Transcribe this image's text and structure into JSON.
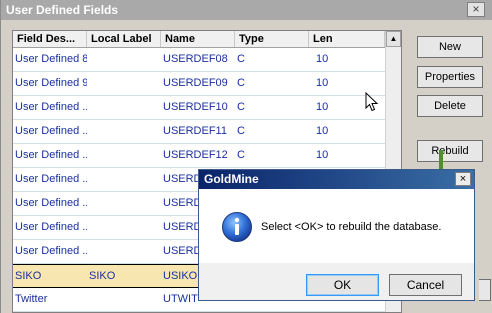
{
  "window": {
    "title": "User Defined Fields",
    "close_glyph": "×"
  },
  "list": {
    "columns": [
      "Field Des...",
      "Local Label",
      "Name",
      "Type",
      "Len"
    ],
    "rows": [
      [
        "User Defined 8",
        "",
        "USERDEF08",
        "C",
        "10"
      ],
      [
        "User Defined 9",
        "",
        "USERDEF09",
        "C",
        "10"
      ],
      [
        "User Defined ...",
        "",
        "USERDEF10",
        "C",
        "10"
      ],
      [
        "User Defined ...",
        "",
        "USERDEF11",
        "C",
        "10"
      ],
      [
        "User Defined ...",
        "",
        "USERDEF12",
        "C",
        "10"
      ],
      [
        "User Defined ...",
        "",
        "USERD",
        "",
        ""
      ],
      [
        "User Defined ...",
        "",
        "USERD",
        "",
        ""
      ],
      [
        "User Defined ...",
        "",
        "USERD",
        "",
        ""
      ],
      [
        "User Defined ...",
        "",
        "USERD",
        "",
        ""
      ],
      [
        "SIKO",
        "SIKO",
        "USIKO",
        "",
        ""
      ],
      [
        "Twitter",
        "",
        "UTWIT",
        "",
        ""
      ]
    ],
    "highlighted_row": 9,
    "scroll_up_glyph": "▲"
  },
  "buttons": {
    "new": "New",
    "properties": "Properties",
    "delete": "Delete",
    "rebuild": "Rebuild"
  },
  "dialog": {
    "title": "GoldMine",
    "close_glyph": "×",
    "message": "Select <OK> to rebuild the database.",
    "icon": "info-icon",
    "ok": "OK",
    "cancel": "Cancel"
  },
  "colors": {
    "dialog_title_start": "#0a246a",
    "dialog_title_end": "#3a6ea5",
    "row_text": "#1a2fa0",
    "highlight_row": "#f7e6b0",
    "annotation_arrow": "#4f8f2f"
  }
}
